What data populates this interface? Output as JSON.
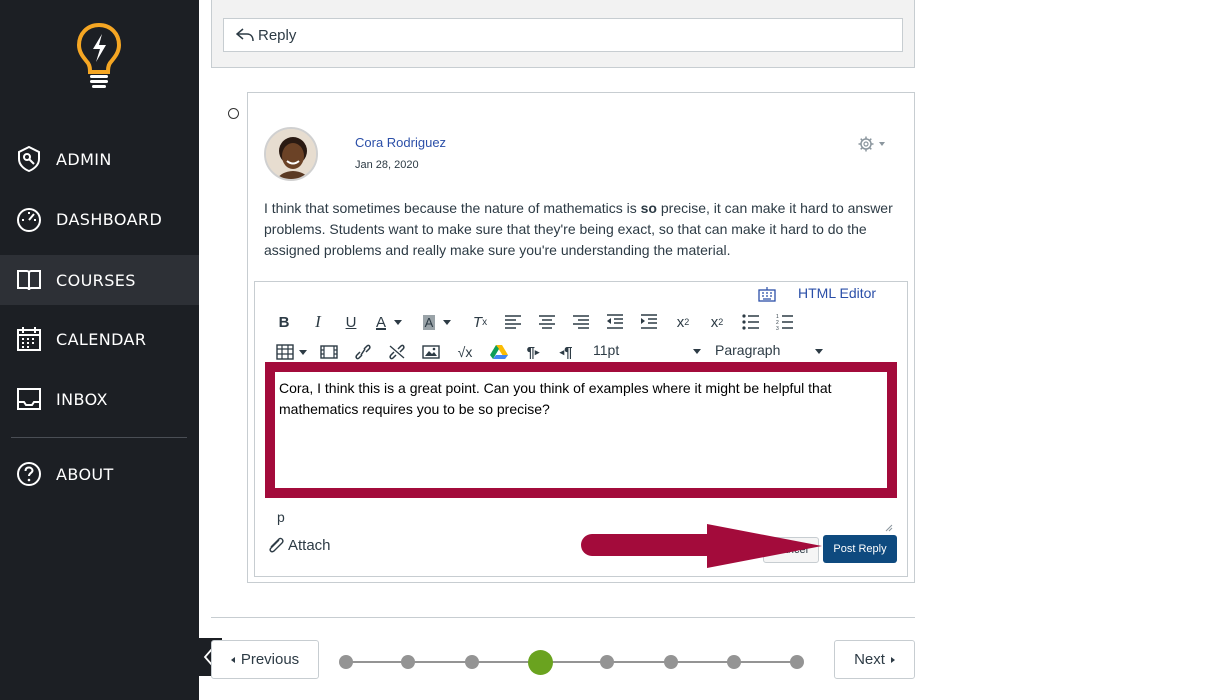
{
  "sidebar": {
    "items": [
      {
        "label": "ADMIN",
        "icon": "admin-shield-icon"
      },
      {
        "label": "DASHBOARD",
        "icon": "speedometer-icon"
      },
      {
        "label": "COURSES",
        "icon": "book-icon",
        "active": true
      },
      {
        "label": "CALENDAR",
        "icon": "calendar-icon"
      },
      {
        "label": "INBOX",
        "icon": "inbox-icon"
      },
      {
        "label": "ABOUT",
        "icon": "question-circle-icon"
      }
    ],
    "logo_color": "#f5a623"
  },
  "main": {
    "reply_label": "Reply",
    "entry": {
      "author": "Cora Rodriguez",
      "date": "Jan 28, 2020",
      "text_before": "I think that sometimes because the nature of mathematics is ",
      "text_bold": "so",
      "text_after": " precise, it can make it hard to answer problems. Students want to make sure that they're being exact, so that can make it hard to do the assigned problems and really make sure you're understanding the material."
    },
    "editor": {
      "html_editor_label": "HTML Editor",
      "font_size": "11pt",
      "block_format": "Paragraph",
      "content": "Cora, I think this is a great point. Can you think of examples where it might be helpful that mathematics requires you to be so precise?",
      "path": "p",
      "attach_label": "Attach",
      "cancel_label": "Cancel",
      "post_label": "Post Reply"
    },
    "pagination": {
      "previous_label": "Previous",
      "next_label": "Next",
      "total_steps": 8,
      "current_step": 4
    }
  },
  "colors": {
    "sidebar_bg": "#1c1f24",
    "highlight_border": "#a30b3b",
    "post_button": "#0e4a7f",
    "current_dot": "#6aa31f"
  }
}
